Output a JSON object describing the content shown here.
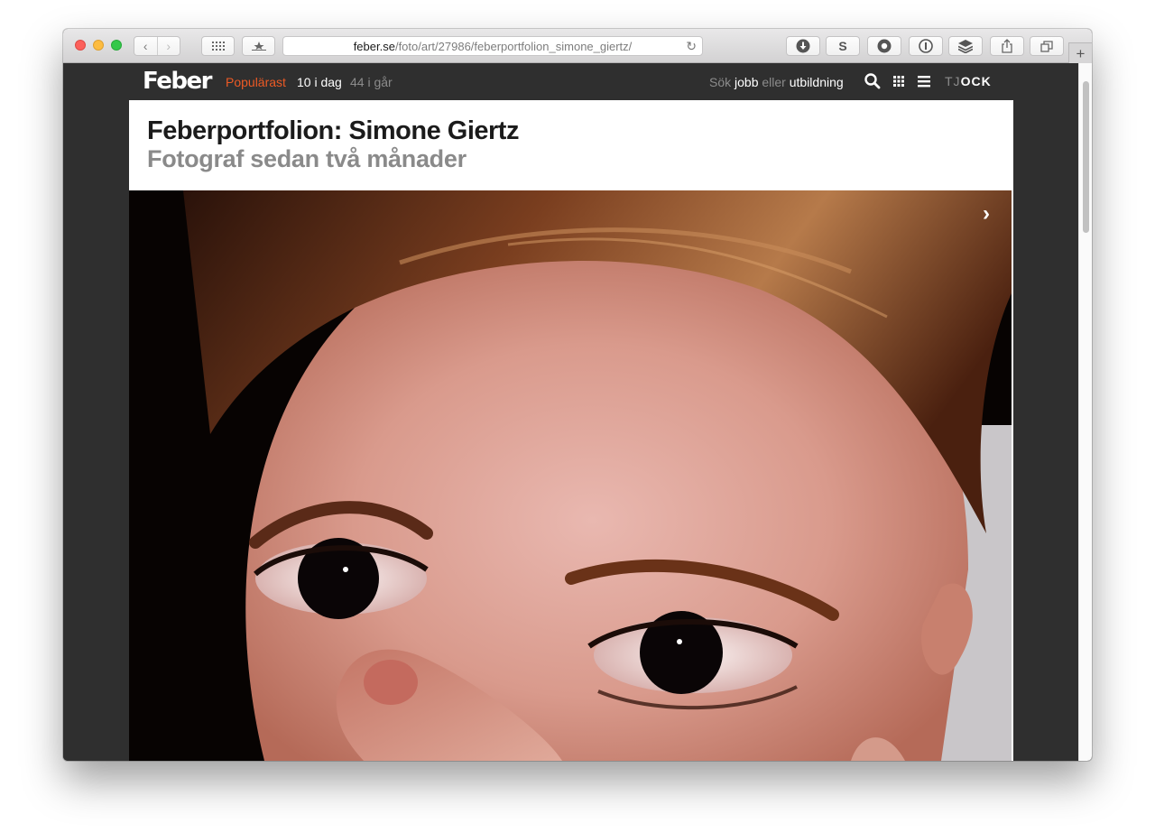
{
  "browser": {
    "url_host": "feber.se",
    "url_path": "/foto/art/27986/feberportfolion_simone_giertz/",
    "extension_s_label": "S"
  },
  "site": {
    "logo": "Feber",
    "nav": {
      "popular": "Populärast",
      "today": "10 i dag",
      "yesterday": "44 i går",
      "jobs_search": "Sök",
      "jobs_jobb": "jobb",
      "jobs_or": "eller",
      "jobs_utbildning": "utbildning",
      "tjock_a": "TJ",
      "tjock_b": "OCK"
    }
  },
  "article": {
    "title": "Feberportfolion: Simone Giertz",
    "subtitle": "Fotograf sedan två månader"
  },
  "colors": {
    "accent": "#ec5a25",
    "nav_bg": "#2f2f2f"
  },
  "icons": {
    "next": "chevron-right-icon",
    "search": "search-icon",
    "grid": "grid-icon",
    "menu": "hamburger-icon"
  }
}
